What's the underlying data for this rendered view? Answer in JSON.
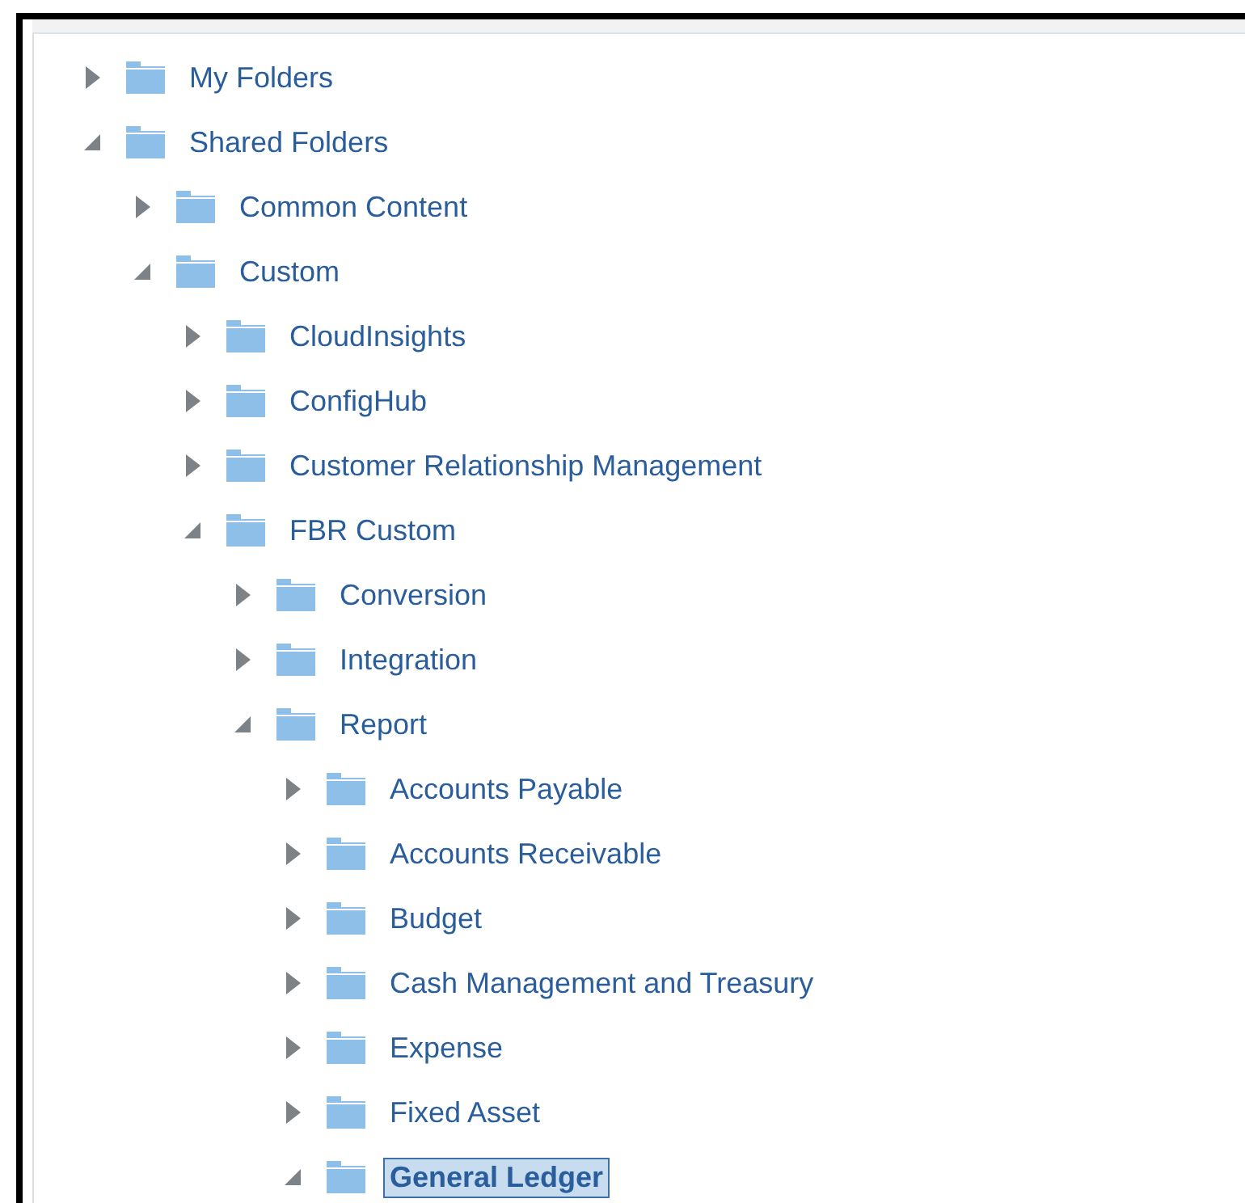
{
  "tree": [
    {
      "label": "My Folders",
      "expanded": false,
      "selected": false
    },
    {
      "label": "Shared Folders",
      "expanded": true,
      "selected": false,
      "children": [
        {
          "label": "Common Content",
          "expanded": false,
          "selected": false
        },
        {
          "label": "Custom",
          "expanded": true,
          "selected": false,
          "children": [
            {
              "label": "CloudInsights",
              "expanded": false,
              "selected": false
            },
            {
              "label": "ConfigHub",
              "expanded": false,
              "selected": false
            },
            {
              "label": "Customer Relationship Management",
              "expanded": false,
              "selected": false
            },
            {
              "label": "FBR Custom",
              "expanded": true,
              "selected": false,
              "children": [
                {
                  "label": "Conversion",
                  "expanded": false,
                  "selected": false
                },
                {
                  "label": "Integration",
                  "expanded": false,
                  "selected": false
                },
                {
                  "label": "Report",
                  "expanded": true,
                  "selected": false,
                  "children": [
                    {
                      "label": "Accounts Payable",
                      "expanded": false,
                      "selected": false
                    },
                    {
                      "label": "Accounts Receivable",
                      "expanded": false,
                      "selected": false
                    },
                    {
                      "label": "Budget",
                      "expanded": false,
                      "selected": false
                    },
                    {
                      "label": "Cash Management and Treasury",
                      "expanded": false,
                      "selected": false
                    },
                    {
                      "label": "Expense",
                      "expanded": false,
                      "selected": false
                    },
                    {
                      "label": "Fixed Asset",
                      "expanded": false,
                      "selected": false
                    },
                    {
                      "label": "General Ledger",
                      "expanded": true,
                      "selected": true
                    }
                  ]
                }
              ]
            }
          ]
        }
      ]
    }
  ]
}
